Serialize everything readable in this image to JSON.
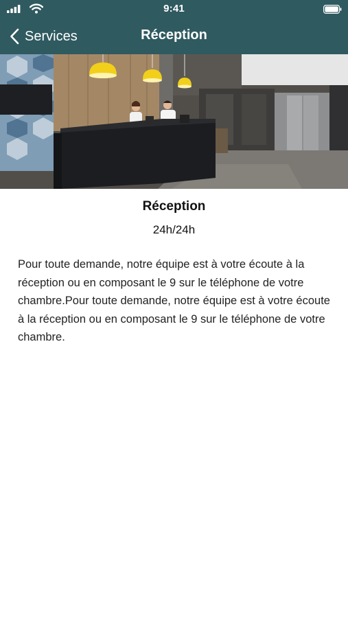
{
  "status_bar": {
    "time": "9:41"
  },
  "nav": {
    "back_label": "Services",
    "title": "Réception"
  },
  "service": {
    "name": "Réception",
    "hours": "24h/24h",
    "description": "Pour toute demande, notre équipe est à votre écoute à la réception ou en composant le 9 sur le téléphone de votre chambre.Pour toute demande, notre équipe est à votre écoute à la réception ou en composant le 9 sur le téléphone de votre chambre."
  },
  "colors": {
    "header_bg": "#2f5a60",
    "text": "#111111"
  },
  "icons": [
    "signal-icon",
    "wifi-icon",
    "battery-icon",
    "back-chevron-icon"
  ]
}
